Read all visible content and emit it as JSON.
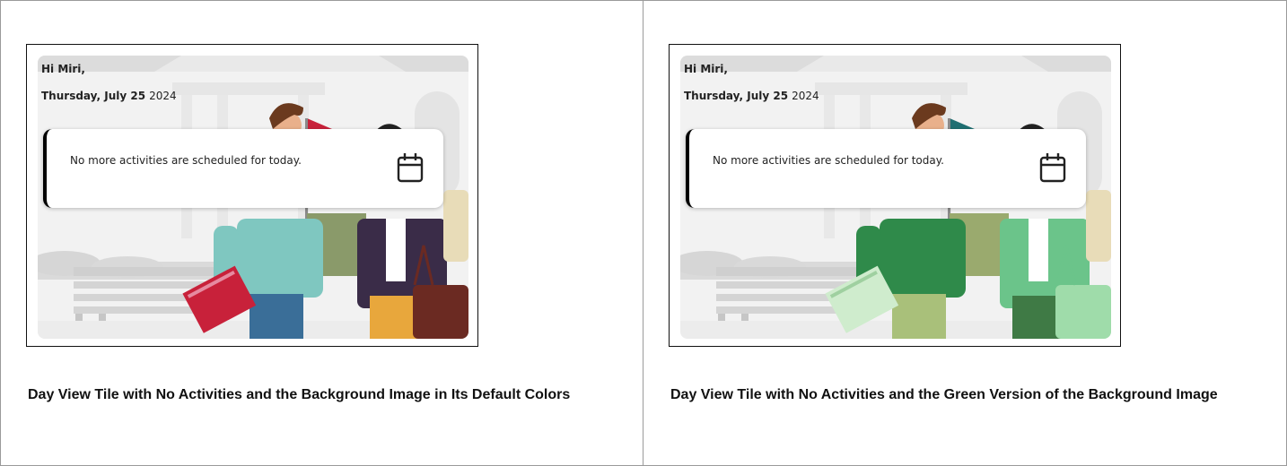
{
  "tiles": [
    {
      "greeting": "Hi Miri,",
      "date_day": "Thursday, July 25",
      "date_year": "2024",
      "message": "No more activities are scheduled for today.",
      "icon": "calendar-icon",
      "palette": "default",
      "caption": "Day View Tile with No Activities and the Background Image in Its Default Colors"
    },
    {
      "greeting": "Hi Miri,",
      "date_day": "Thursday, July 25",
      "date_year": "2024",
      "message": "No more activities are scheduled for today.",
      "icon": "calendar-icon",
      "palette": "green",
      "caption": "Day View Tile with No Activities and the Green Version of the Background Image"
    }
  ],
  "colors": {
    "default": {
      "person_a_top": "#7fc7c0",
      "person_a_pants": "#3a6e98",
      "book_a": "#c8213a",
      "person_b_coat": "#3a2c48",
      "person_b_pants": "#e8a73c",
      "bag": "#6b2a22",
      "flag": "#c8213a",
      "sign": "#8a9a6a"
    },
    "green": {
      "person_a_top": "#2f8a4a",
      "person_a_pants": "#a9c07a",
      "book_a": "#cfeccd",
      "person_b_coat": "#6bc48a",
      "person_b_pants": "#3f7a45",
      "bag": "#9fdcaa",
      "flag": "#1f6f72",
      "sign": "#9aaa6e"
    }
  }
}
